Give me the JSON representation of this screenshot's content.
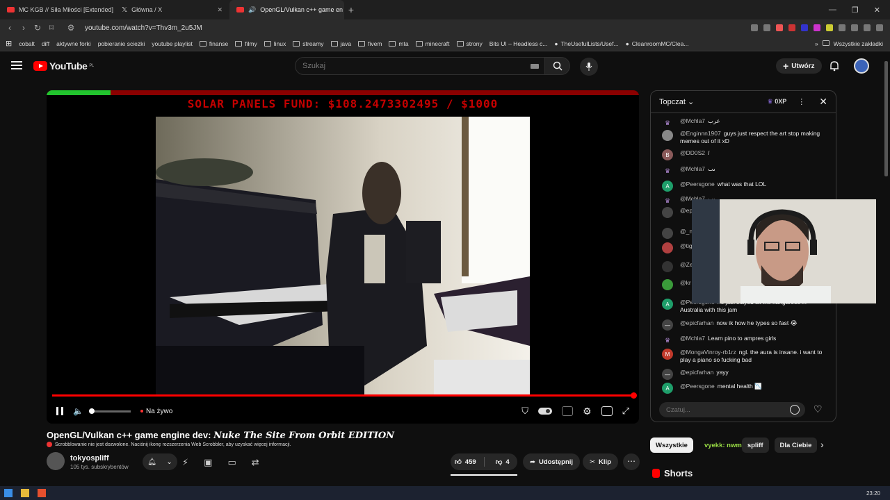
{
  "browser": {
    "tabs": [
      {
        "label": "MC KGB // Siła Miłości [Extended] m"
      },
      {
        "label": "Główna / X"
      },
      {
        "label": "OpenGL/Vulkan c++ game en"
      }
    ],
    "url": "youtube.com/watch?v=Thv3m_2u5JM",
    "bookmarks": [
      "cobalt",
      "diff",
      "aktywne forki",
      "pobieranie sciezki",
      "youtube playlist",
      "finanse",
      "filmy",
      "linux",
      "streamy",
      "java",
      "fivem",
      "mta",
      "minecraft",
      "strony",
      "Bits UI – Headless c...",
      "TheUsefulLists/Usef...",
      "CleanroomMC/Clea..."
    ],
    "all_bookmarks": "Wszystkie zakładki"
  },
  "yt": {
    "logo": "YouTube",
    "logo_region": "PL",
    "search_placeholder": "Szukaj",
    "create_label": "Utwórz"
  },
  "video": {
    "fund_text": "SOLAR PANELS FUND: $108.2473302495 / $1000",
    "fund_progress": 0.108,
    "live_label": "Na żywo",
    "title_plain": "OpenGL/Vulkan c++ game engine dev: ",
    "title_styled": "Nuke The Site From Orbit EDITION",
    "scrobble_warning": "Scrobblowanie nie jest dozwolone. Naciśnij ikonę rozszerzenia Web Scrobbler, aby uzyskać więcej informacji.",
    "channel_name": "tokyospliff",
    "subscribers": "105 tys. subskrybentów",
    "likes": "459",
    "dislikes": "4",
    "share_label": "Udostępnij",
    "clip_label": "Klip"
  },
  "chat": {
    "header": "Topczat",
    "xp": "0XP",
    "input_placeholder": "Czatuj...",
    "messages": [
      {
        "user": "@Mchla7",
        "text": "عرب",
        "color": "#b48cd8",
        "initial": "♛"
      },
      {
        "user": "@Enginnn1907",
        "text": "guys just respect the art stop making memes out of it xD",
        "color": "#888888",
        "initial": ""
      },
      {
        "user": "@DD0S2",
        "text": "/",
        "color": "#8a5a5a",
        "initial": "B"
      },
      {
        "user": "@Mchla7",
        "text": "ٮ‍‍‍‍‍‍‍ٮ",
        "color": "#b48cd8",
        "initial": "♛"
      },
      {
        "user": "@Peersgone",
        "text": "what was that LOL",
        "color": "#1e9e6a",
        "initial": "A"
      },
      {
        "user": "@Mchla7",
        "text": "ٮ‍‍‍‍‍‍‍‍‍‍‍‍‍‍‍‍‍ٮ",
        "color": "#b48cd8",
        "initial": "♛"
      },
      {
        "user": "@ep",
        "text": "danc",
        "color": "#444444",
        "initial": ""
      },
      {
        "user": "@_n",
        "text": "codi",
        "color": "#444444",
        "initial": ""
      },
      {
        "user": "@tig",
        "text": "to ex",
        "color": "#b04040",
        "initial": ""
      },
      {
        "user": "@Ze",
        "text": "havi",
        "color": "#333333",
        "initial": ""
      },
      {
        "user": "@kr",
        "text": "just",
        "color": "#3a9a3a",
        "initial": ""
      },
      {
        "user": "@Peersgone",
        "text": "he just slayed all the kangaroos in Australia with this jam",
        "color": "#1e9e6a",
        "initial": "A"
      },
      {
        "user": "@epicfarhan",
        "text": "now ik how he types so fast 😭",
        "color": "#444444",
        "initial": "—"
      },
      {
        "user": "@Mchla7",
        "text": "Learn pino to ampres girls",
        "color": "#b48cd8",
        "initial": "♛"
      },
      {
        "user": "@MongaVinroy-rb1rz",
        "text": "ngl. the aura is insane. i want to play a piano so fucking bad",
        "color": "#c0392b",
        "initial": "M"
      },
      {
        "user": "@epicfarhan",
        "text": "yayy",
        "color": "#444444",
        "initial": "—"
      },
      {
        "user": "@Peersgone",
        "text": "mental health 📉",
        "color": "#1e9e6a",
        "initial": "A"
      }
    ]
  },
  "sidebar": {
    "chips": [
      "Wszystkie",
      "vyekk: nwm",
      "spliff",
      "Dla Ciebie"
    ],
    "shorts_label": "Shorts"
  },
  "taskbar": {
    "time": "23:20"
  }
}
